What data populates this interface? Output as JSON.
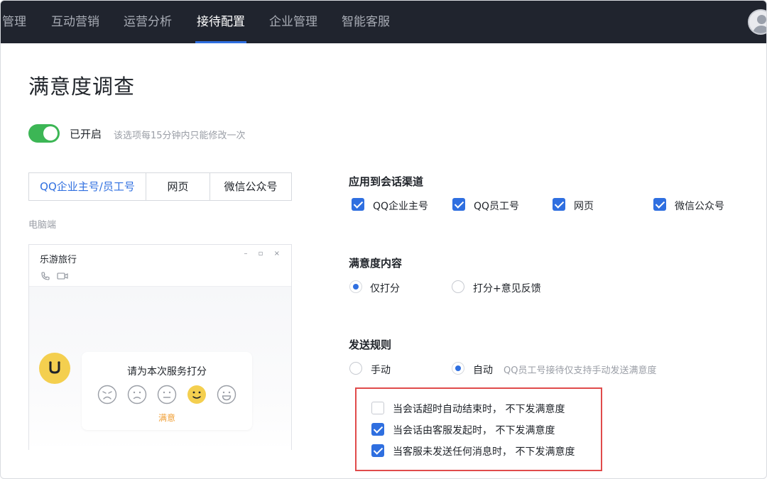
{
  "nav": {
    "items": [
      {
        "label": "管理",
        "active": false
      },
      {
        "label": "互动营销",
        "active": false
      },
      {
        "label": "运营分析",
        "active": false
      },
      {
        "label": "接待配置",
        "active": true
      },
      {
        "label": "企业管理",
        "active": false
      },
      {
        "label": "智能客服",
        "active": false
      }
    ]
  },
  "page": {
    "title": "满意度调查"
  },
  "toggle": {
    "state_label": "已开启",
    "hint": "该选项每15分钟内只能修改一次",
    "on": true
  },
  "tabs": [
    {
      "label": "QQ企业主号/员工号",
      "active": true
    },
    {
      "label": "网页",
      "active": false
    },
    {
      "label": "微信公众号",
      "active": false
    }
  ],
  "preview": {
    "device_label": "电脑端",
    "window_title": "乐游旅行",
    "window_controls": "– ▫ ×",
    "rating_title": "请为本次服务打分",
    "rating_caption": "满意",
    "faces": [
      "very-unhappy-face-icon",
      "unhappy-face-icon",
      "neutral-face-icon",
      "happy-face-icon",
      "very-happy-face-icon"
    ],
    "selected_face_index": 3
  },
  "channels": {
    "title": "应用到会话渠道",
    "options": [
      {
        "label": "QQ企业主号",
        "checked": true
      },
      {
        "label": "QQ员工号",
        "checked": true
      },
      {
        "label": "网页",
        "checked": true
      },
      {
        "label": "微信公众号",
        "checked": true
      }
    ]
  },
  "content": {
    "title": "满意度内容",
    "options": [
      {
        "label": "仅打分",
        "selected": true
      },
      {
        "label": "打分+意见反馈",
        "selected": false
      }
    ]
  },
  "send_rules": {
    "title": "发送规则",
    "options": [
      {
        "label": "手动",
        "selected": false
      },
      {
        "label": "自动",
        "selected": true
      }
    ],
    "hint": "QQ员工号接待仅支持手动发送满意度",
    "conditions": [
      {
        "label": "当会话超时自动结束时， 不下发满意度",
        "checked": false
      },
      {
        "label": "当会话由客服发起时， 不下发满意度",
        "checked": true
      },
      {
        "label": "当客服未发送任何消息时， 不下发满意度",
        "checked": true
      }
    ]
  },
  "colors": {
    "accent": "#2f6fe0",
    "nav_bg": "#20242e",
    "toggle_on": "#3cb655",
    "highlight_box": "#e04b4b",
    "rating_caption": "#f0a038"
  }
}
